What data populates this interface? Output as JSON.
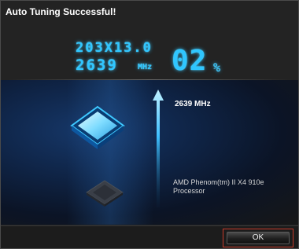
{
  "dialog": {
    "title": "Auto Tuning Successful!"
  },
  "readout": {
    "multiplier": "203X13.0",
    "frequency": "2639",
    "frequency_unit": "MHz",
    "percent": "02",
    "percent_sign": "%"
  },
  "status": {
    "tuned_frequency": "2639 MHz",
    "processor_line1": "AMD Phenom(tm) II X4 910e",
    "processor_line2": "Processor"
  },
  "footer": {
    "ok_label": "OK"
  },
  "colors": {
    "accent": "#2fc6ff",
    "highlight_outline": "#c53a2a",
    "background": "#232323"
  }
}
